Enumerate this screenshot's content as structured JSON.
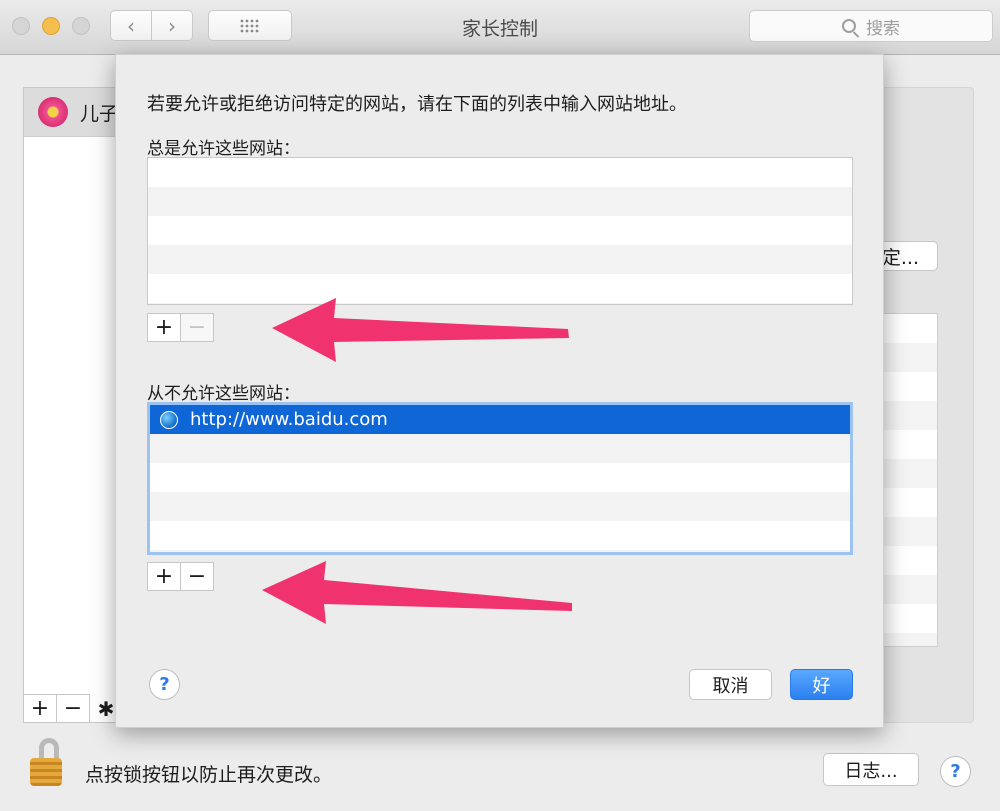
{
  "window": {
    "title": "家长控制",
    "search_placeholder": "搜索"
  },
  "background": {
    "user_name": "儿子",
    "button_fragment": "定...",
    "lock_message": "点按锁按钮以防止再次更改。",
    "log_button": "日志...",
    "help": "?",
    "plus": "+",
    "minus": "−",
    "gear": "✱"
  },
  "sheet": {
    "instruction": "若要允许或拒绝访问特定的网站，请在下面的列表中输入网站地址。",
    "allow_label": "总是允许这些网站：",
    "allow_sites": [],
    "deny_label": "从不允许这些网站：",
    "deny_sites": [
      "http://www.baidu.com"
    ],
    "plus": "+",
    "minus": "−",
    "help": "?",
    "cancel_label": "取消",
    "ok_label": "好"
  },
  "colors": {
    "accent": "#2a80f0",
    "selection": "#0f66d6",
    "annotation_arrow": "#f0336e"
  }
}
